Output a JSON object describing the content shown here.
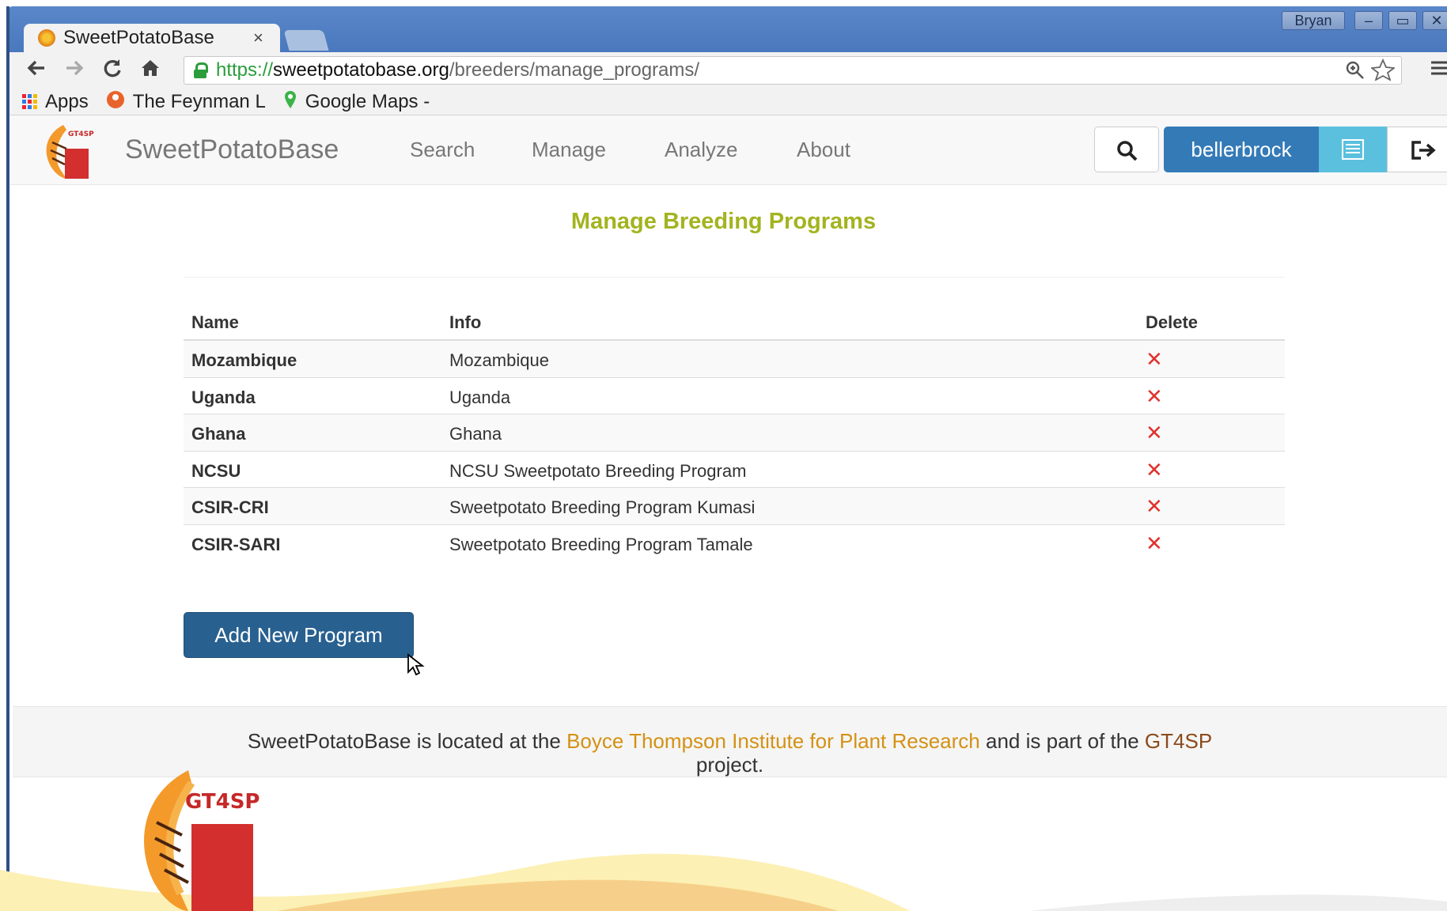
{
  "browser": {
    "profile_name": "Bryan",
    "window_controls": [
      "–",
      "▭",
      "✕"
    ],
    "tab_title": "SweetPotatoBase",
    "tab_close": "×",
    "url_scheme": "https://",
    "url_host": "sweetpotatobase.org",
    "url_path": "/breeders/manage_programs/",
    "bookmarks": [
      {
        "label": "Apps",
        "icon": "apps-grid-icon"
      },
      {
        "label": "The Feynman L",
        "icon": "feynman-icon"
      },
      {
        "label": "Google Maps -",
        "icon": "maps-pin-icon"
      }
    ]
  },
  "navbar": {
    "brand": "SweetPotatoBase",
    "logo_text": "GT4SP",
    "links": [
      "Search",
      "Manage",
      "Analyze",
      "About"
    ],
    "user": "bellerbrock"
  },
  "page": {
    "title": "Manage Breeding Programs",
    "table": {
      "headers": [
        "Name",
        "Info",
        "Delete"
      ],
      "rows": [
        {
          "name": "Mozambique",
          "info": "Mozambique",
          "delete": "✕"
        },
        {
          "name": "Uganda",
          "info": "Uganda",
          "delete": "✕"
        },
        {
          "name": "Ghana",
          "info": "Ghana",
          "delete": "✕"
        },
        {
          "name": "NCSU",
          "info": "NCSU Sweetpotato Breeding Program",
          "delete": "✕"
        },
        {
          "name": "CSIR-CRI",
          "info": "Sweetpotato Breeding Program Kumasi",
          "delete": "✕"
        },
        {
          "name": "CSIR-SARI",
          "info": "Sweetpotato Breeding Program Tamale",
          "delete": "✕"
        }
      ]
    },
    "add_button": "Add New Program"
  },
  "footer": {
    "text_1": "SweetPotatoBase is located at the",
    "link_1": "Boyce Thompson Institute for Plant Research",
    "text_2": "and is part of the",
    "link_2": "GT4SP",
    "text_3": "project.",
    "logo_text": "GT4SP"
  },
  "colors": {
    "title_green": "#a2b41f",
    "primary_blue": "#337ab7",
    "info_cyan": "#5bc0de",
    "delete_red": "#e0322d",
    "footer_link": "#d49114"
  }
}
